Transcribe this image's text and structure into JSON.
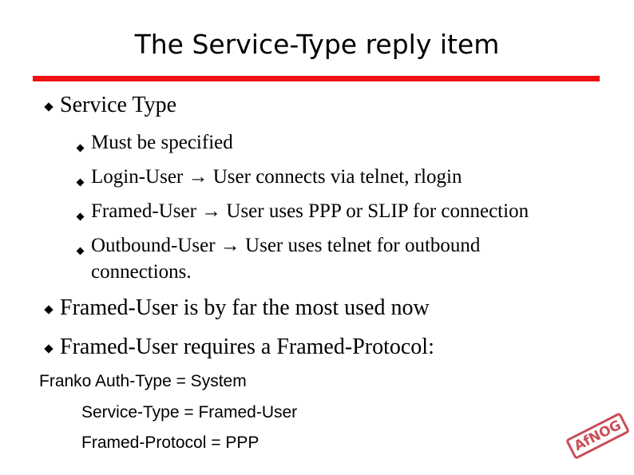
{
  "slide": {
    "title": "The Service-Type reply item",
    "bullets": [
      {
        "text": "Service Type",
        "subbullets": [
          {
            "text": "Must be specified"
          },
          {
            "text": "Login-User → User connects via telnet, rlogin"
          },
          {
            "text": "Framed-User → User uses PPP or SLIP for connection"
          },
          {
            "text_line1": "Outbound-User → User uses telnet for outbound",
            "text_line2": "connections."
          }
        ]
      },
      {
        "text": "Framed-User is by far the most used now"
      },
      {
        "text": "Framed-User requires a Framed-Protocol:"
      }
    ],
    "config": {
      "line1": "Franko  Auth-Type = System",
      "line2": "Service-Type = Framed-User",
      "line3": "Framed-Protocol = PPP"
    },
    "logo": "AfNOG",
    "colors": {
      "rule": "#ee1111",
      "logo": "#c0303a"
    }
  }
}
